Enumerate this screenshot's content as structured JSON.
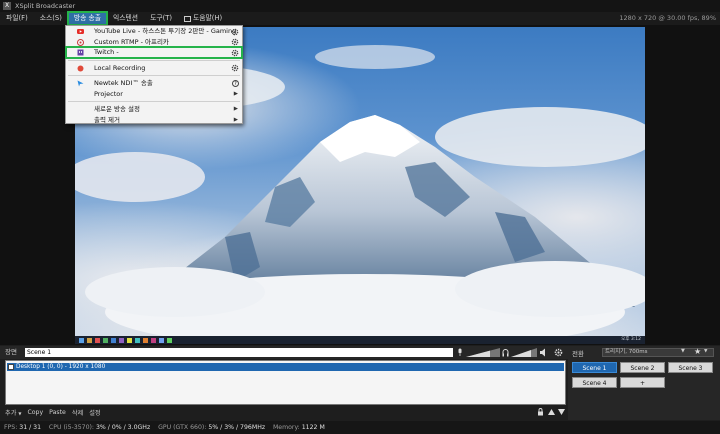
{
  "window": {
    "title": "XSplit Broadcaster",
    "resolution_info": "1280 x 720 @ 30.00 fps, 89%"
  },
  "menubar": {
    "items": [
      "파일(F)",
      "소스(S)",
      "방송 송출",
      "익스텐션",
      "도구(T)",
      "도움말(H)"
    ]
  },
  "dropdown": {
    "youtube": "YouTube Live - 하스스톤 투기장 2판만 - Gaming",
    "custom_rtmp": "Custom RTMP - 아프리카",
    "twitch": "Twitch -",
    "local_recording": "Local Recording",
    "ndi": "Newtek NDI™ 송출",
    "projector": "Projector",
    "new_output": "새로운 방송 설정",
    "remove_output": "출력 제거"
  },
  "scene": {
    "label": "장면",
    "name": "Scene 1"
  },
  "sources": {
    "rows": [
      "Desktop 1 (0, 0) - 1920 x 1080"
    ]
  },
  "source_toolbar": {
    "add": "추가",
    "copy": "Copy",
    "paste": "Paste",
    "delete": "삭제",
    "settings": "설정"
  },
  "transition": {
    "label": "전환",
    "value": "트리지기, 700ms"
  },
  "scenes": [
    "Scene 1",
    "Scene 2",
    "Scene 3",
    "Scene 4",
    "+"
  ],
  "taskbar": {
    "time": "오후 3:12"
  },
  "status": {
    "fps_label": "FPS:",
    "fps": "31 / 31",
    "cpu_label": "CPU (i5-3570):",
    "cpu": "3% / 0% / 3.0GHz",
    "gpu_label": "GPU (GTX 660):",
    "gpu": "5% / 3% / 796MHz",
    "mem_label": "Memory:",
    "mem": "1122 M"
  },
  "colors": {
    "accent": "#1f67b0",
    "highlight_box": "#25b34a"
  }
}
